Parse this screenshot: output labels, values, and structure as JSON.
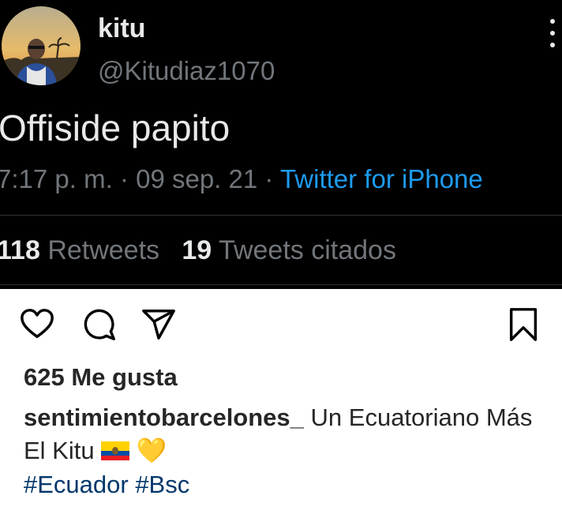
{
  "tweet": {
    "display_name": "kitu",
    "handle": "@Kitudiaz1070",
    "text": "Offiside papito",
    "time": "7:17 p. m.",
    "date": "09 sep. 21",
    "source": "Twitter for iPhone",
    "sep": "·",
    "retweets_count": "118",
    "retweets_label": "Retweets",
    "quotes_count": "19",
    "quotes_label": "Tweets citados"
  },
  "instagram": {
    "likes": "625 Me gusta",
    "caption_user": "sentimientobarcelones_",
    "caption_text": "Un Ecuatoriano Más El Kitu",
    "caption_emoji": "💛",
    "hashtags": "#Ecuador #Bsc",
    "icons": [
      "heart-icon",
      "comment-icon",
      "share-icon",
      "bookmark-icon"
    ],
    "colors": {
      "tweet_bg": "#000000",
      "link_blue": "#1d9bf0",
      "hashtag_blue": "#00376b"
    }
  }
}
